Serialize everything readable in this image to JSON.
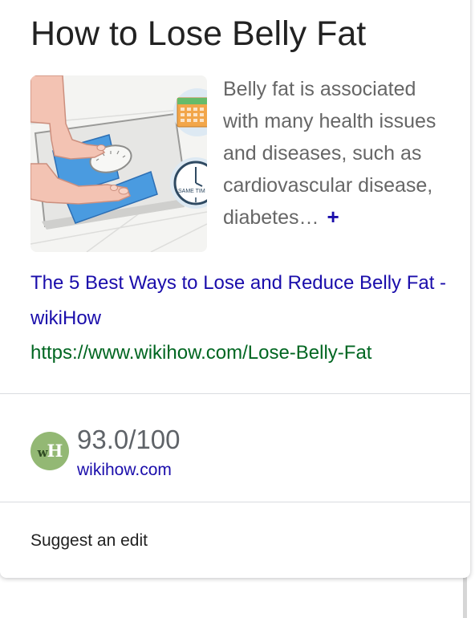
{
  "knowledge_card": {
    "title": "How to Lose Belly Fat",
    "thumbnail_label": "SAME TIM",
    "description": "Belly fat is associated with many health issues and diseases, such as cardiovascular disease, diabetes…",
    "more_label": "+",
    "result": {
      "link_text": "The 5 Best Ways to Lose and Reduce Belly Fat - wikiHow",
      "url": "https://www.wikihow.com/Lose-Belly-Fat"
    },
    "rating": {
      "logo_letters": [
        "w",
        "H"
      ],
      "score": "93.0/100",
      "source": "wikihow.com"
    },
    "suggest_edit_label": "Suggest an edit"
  },
  "colors": {
    "link": "#1a0dab",
    "url": "#006621",
    "logo_bg": "#93b874",
    "title": "#222222",
    "muted": "#666666"
  },
  "icons": {
    "expand": "plus-icon",
    "calendar": "calendar-icon",
    "clock": "clock-icon",
    "scale": "bathroom-scale"
  }
}
